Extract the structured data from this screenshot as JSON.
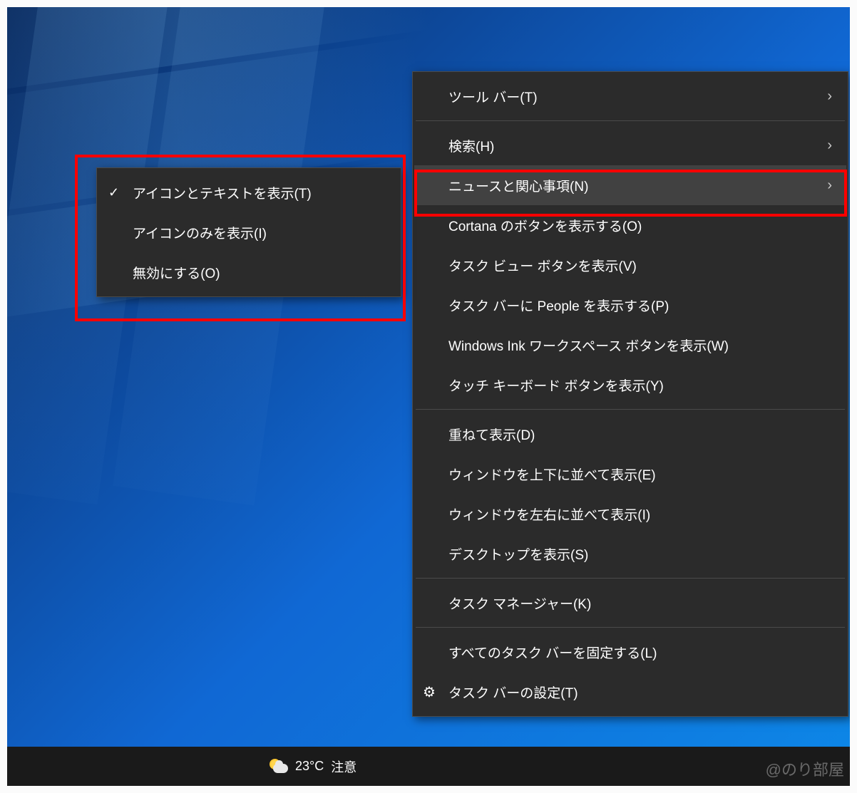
{
  "desktop": {
    "watermark": "@のり部屋"
  },
  "taskbar": {
    "weather": {
      "temp": "23°C",
      "condition": "注意"
    }
  },
  "mainMenu": {
    "items": [
      {
        "label": "ツール バー(T)",
        "hasSubmenu": true
      },
      {
        "label": "検索(H)",
        "hasSubmenu": true
      },
      {
        "label": "ニュースと関心事項(N)",
        "hasSubmenu": true,
        "highlighted": true
      },
      {
        "label": "Cortana のボタンを表示する(O)"
      },
      {
        "label": "タスク ビュー ボタンを表示(V)"
      },
      {
        "label": "タスク バーに People を表示する(P)"
      },
      {
        "label": "Windows Ink ワークスペース ボタンを表示(W)"
      },
      {
        "label": "タッチ キーボード ボタンを表示(Y)"
      },
      {
        "label": "重ねて表示(D)"
      },
      {
        "label": "ウィンドウを上下に並べて表示(E)"
      },
      {
        "label": "ウィンドウを左右に並べて表示(I)"
      },
      {
        "label": "デスクトップを表示(S)"
      },
      {
        "label": "タスク マネージャー(K)"
      },
      {
        "label": "すべてのタスク バーを固定する(L)"
      },
      {
        "label": "タスク バーの設定(T)",
        "hasIcon": true
      }
    ]
  },
  "subMenu": {
    "items": [
      {
        "label": "アイコンとテキストを表示(T)",
        "checked": true
      },
      {
        "label": "アイコンのみを表示(I)"
      },
      {
        "label": "無効にする(O)"
      }
    ]
  }
}
